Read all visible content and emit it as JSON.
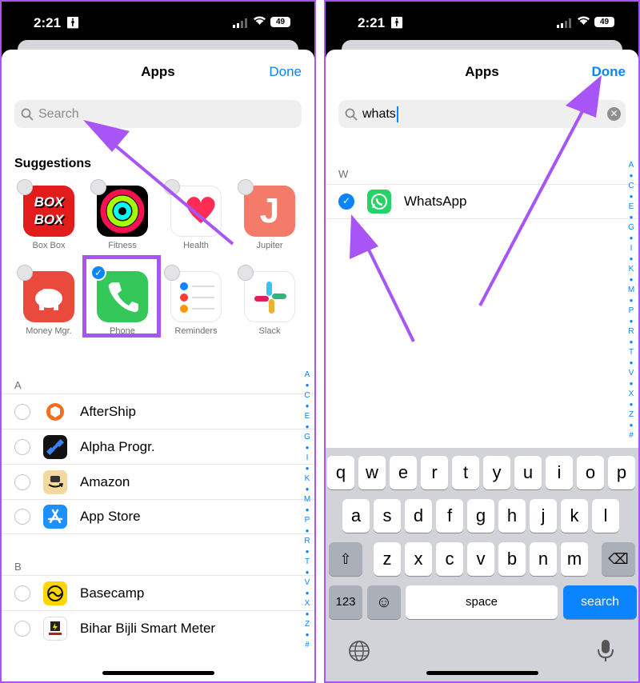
{
  "left": {
    "status": {
      "time": "2:21",
      "battery": "49"
    },
    "title": "Apps",
    "done": "Done",
    "search_placeholder": "Search",
    "suggestions_header": "Suggestions",
    "suggestions": [
      {
        "label": "Box Box",
        "icon": "boxbox-icon",
        "color": "#e21b1b",
        "selected": false
      },
      {
        "label": "Fitness",
        "icon": "fitness-icon",
        "color": "#000000",
        "selected": false
      },
      {
        "label": "Health",
        "icon": "health-icon",
        "color": "#ffffff",
        "selected": false
      },
      {
        "label": "Jupiter",
        "icon": "jupiter-icon",
        "color": "#f47a6a",
        "selected": false
      },
      {
        "label": "Money Mgr.",
        "icon": "piggy-bank-icon",
        "color": "#ea4a3b",
        "selected": false
      },
      {
        "label": "Phone",
        "icon": "phone-icon",
        "color": "#34c759",
        "selected": true
      },
      {
        "label": "Reminders",
        "icon": "reminders-icon",
        "color": "#ffffff",
        "selected": false
      },
      {
        "label": "Slack",
        "icon": "slack-icon",
        "color": "#ffffff",
        "selected": false
      }
    ],
    "boxbox_text": "BOX BOX",
    "jupiter_letter": "J",
    "section_a": "A",
    "section_b": "B",
    "apps_a": [
      {
        "name": "AfterShip",
        "color": "#f26f21"
      },
      {
        "name": "Alpha Progr.",
        "color": "#111111"
      },
      {
        "name": "Amazon",
        "color": "#f3d9a0"
      },
      {
        "name": "App Store",
        "color": "#1e90ff"
      }
    ],
    "apps_b": [
      {
        "name": "Basecamp",
        "color": "#ffd600"
      },
      {
        "name": "Bihar Bijli Smart Meter",
        "color": "#ffffff"
      }
    ]
  },
  "right": {
    "status": {
      "time": "2:21",
      "battery": "49"
    },
    "title": "Apps",
    "done": "Done",
    "search_value": "whats",
    "section_w": "W",
    "result": {
      "name": "WhatsApp",
      "selected": true,
      "color": "#25d366"
    },
    "keyboard": {
      "row1": [
        "q",
        "w",
        "e",
        "r",
        "t",
        "y",
        "u",
        "i",
        "o",
        "p"
      ],
      "row2": [
        "a",
        "s",
        "d",
        "f",
        "g",
        "h",
        "j",
        "k",
        "l"
      ],
      "row3": [
        "z",
        "x",
        "c",
        "v",
        "b",
        "n",
        "m"
      ],
      "numbers": "123",
      "space": "space",
      "search": "search"
    }
  },
  "index_letters": [
    "A",
    "C",
    "E",
    "G",
    "I",
    "K",
    "M",
    "P",
    "R",
    "T",
    "V",
    "X",
    "Z",
    "#"
  ],
  "colors": {
    "accent": "#0a84ff",
    "annotation": "#a855f7"
  }
}
